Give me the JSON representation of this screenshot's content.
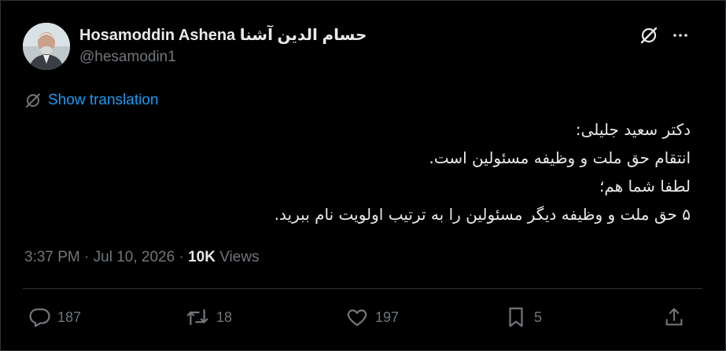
{
  "author": {
    "name": "Hosamoddin Ashena حسام الدین آشنا",
    "handle": "@hesamodin1"
  },
  "translation_link": "Show translation",
  "tweet_lines": [
    "دکتر سعید جلیلی:",
    "انتقام حق ملت و وظیفه مسئولین است.",
    "لطفا شما هم؛",
    "۵ حق ملت و وظیفه دیگر مسئولین را به ترتیب اولویت نام ببرید."
  ],
  "meta": {
    "time": "3:37 PM",
    "separator": "·",
    "date": "Jul 10, 2026",
    "views_count": "10K",
    "views_label": "Views"
  },
  "actions": {
    "replies": "187",
    "reposts": "18",
    "likes": "197",
    "bookmarks": "5"
  },
  "colors": {
    "background": "#000000",
    "text": "#e7e9ea",
    "muted": "#71767b",
    "link": "#1d9bf0",
    "border": "#2f3336"
  },
  "icons": [
    "grok-icon",
    "more-icon",
    "translate-icon",
    "reply-icon",
    "repost-icon",
    "like-icon",
    "bookmark-icon",
    "share-icon"
  ]
}
